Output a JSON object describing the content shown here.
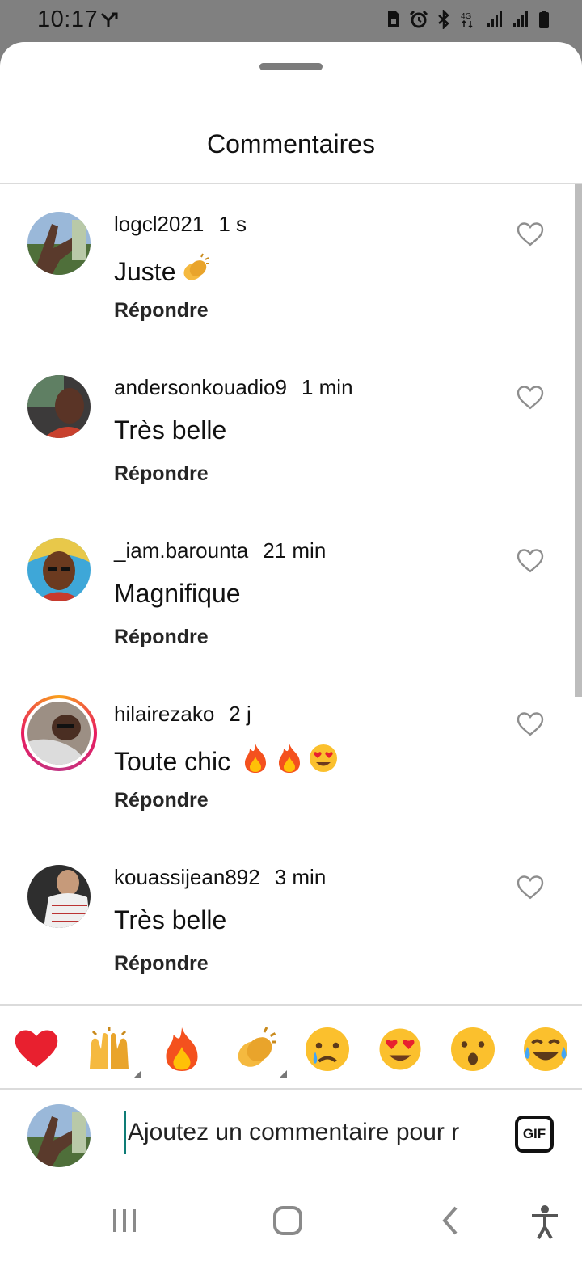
{
  "status_bar": {
    "time": "10:17",
    "icons": [
      "network-icon",
      "sim-icon",
      "alarm-icon",
      "bluetooth-icon",
      "4g-icon",
      "signal-icon",
      "signal-icon",
      "battery-icon"
    ]
  },
  "sheet": {
    "title": "Commentaires"
  },
  "comments": [
    {
      "username": "logcl2021",
      "time": "1 s",
      "text": "Juste",
      "emojis": [
        "clapping-hands"
      ],
      "reply": "Répondre",
      "avatar": "avatar-hand-outdoors"
    },
    {
      "username": "andersonkouadio9",
      "time": "1 min",
      "text": "Très belle",
      "emojis": [],
      "reply": "Répondre",
      "avatar": "avatar-man-selfie"
    },
    {
      "username": "_iam.barounta",
      "time": "21 min",
      "text": "Magnifique",
      "emojis": [],
      "reply": "Répondre",
      "avatar": "avatar-illustrated-portrait"
    },
    {
      "username": "hilairezako",
      "time": "2 j",
      "text": "Toute chic",
      "emojis": [
        "fire",
        "fire",
        "heart-eyes"
      ],
      "reply": "Répondre",
      "avatar": "avatar-man-glasses",
      "story_ring": true
    },
    {
      "username": "kouassijean892",
      "time": "3 min",
      "text": "Très belle",
      "emojis": [],
      "reply": "Répondre",
      "avatar": "avatar-man-jersey"
    }
  ],
  "emoji_bar": [
    "red-heart",
    "raising-hands",
    "fire",
    "clapping-hands",
    "crying-face",
    "heart-eyes",
    "surprised-face",
    "tears-of-joy"
  ],
  "composer": {
    "placeholder": "Ajoutez un commentaire pour r",
    "gif_label": "GIF"
  },
  "nav_bar": [
    "recent-apps-icon",
    "home-icon",
    "back-icon",
    "accessibility-icon"
  ],
  "colors": {
    "heart": "#e8202f",
    "story_ring_start": "#f9a21b",
    "story_ring_end": "#c13584",
    "cursor": "#0e7c76"
  }
}
